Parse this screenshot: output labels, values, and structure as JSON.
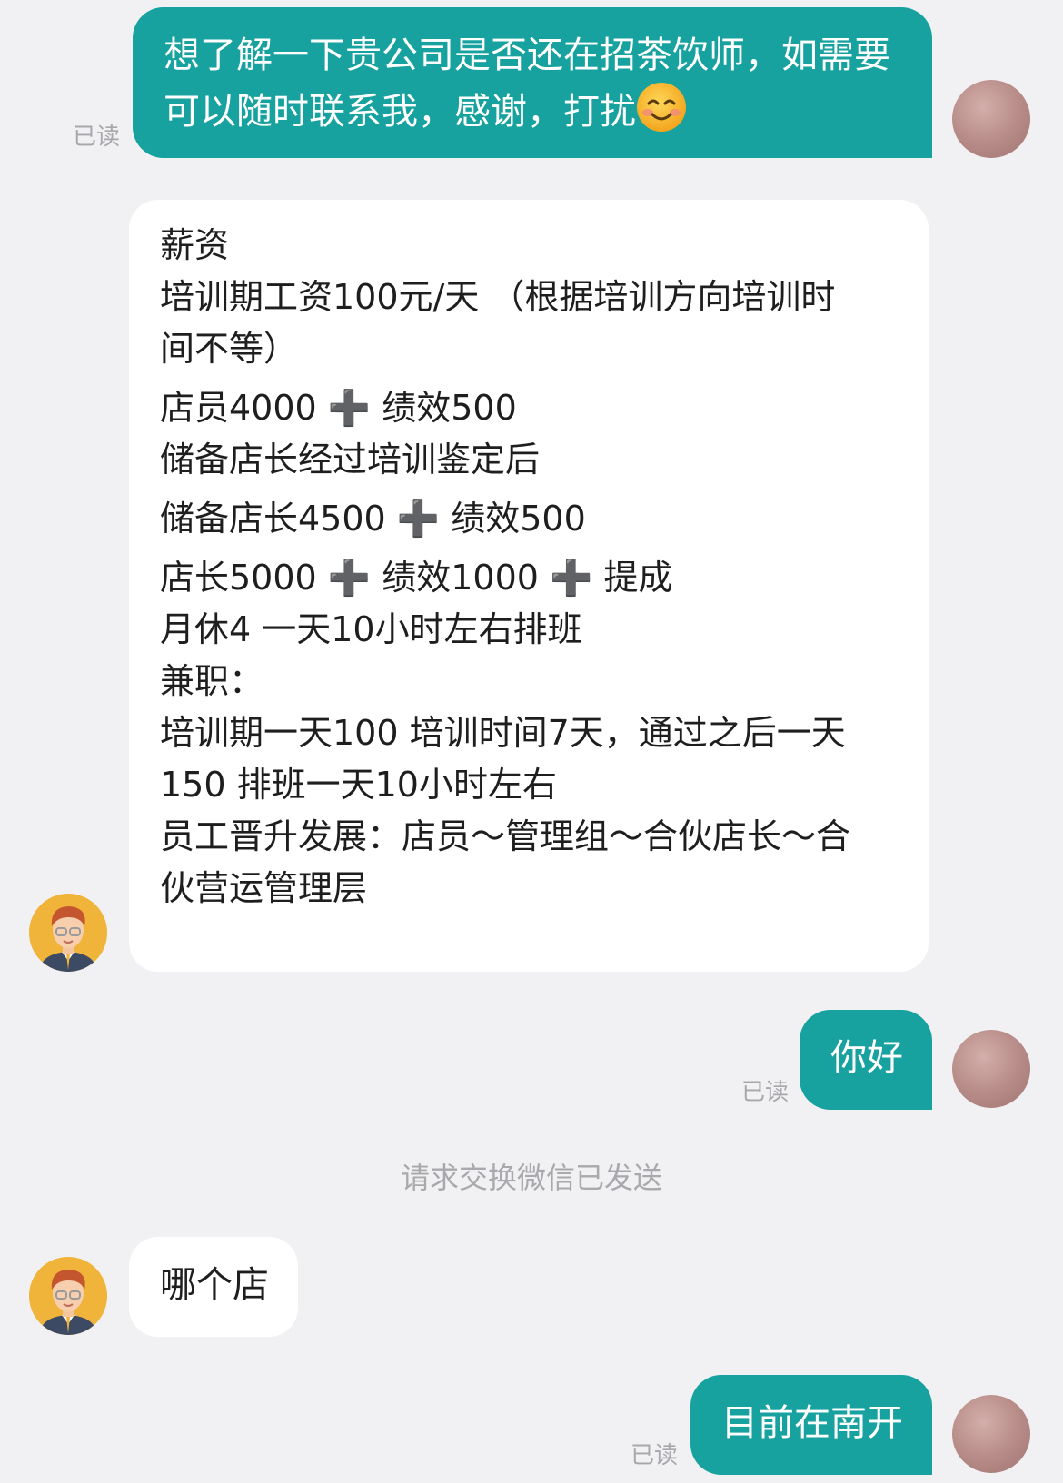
{
  "messages": [
    {
      "type": "outgoing",
      "text_main": "想了解一下贵公司是否还在招茶饮师，如需要",
      "text_second": "可以随时联系我，感谢，打扰",
      "emoji": "smiling-face-emoji",
      "read_label": "已读"
    },
    {
      "type": "incoming",
      "lines": [
        "薪资",
        "培训期工资100元/天 （根据培训方向培训时",
        "间不等）"
      ],
      "salary_lines": [
        {
          "before": "店员4000",
          "after": "绩效500"
        },
        {
          "before": "储备店长经过培训鉴定后",
          "after": ""
        },
        {
          "before": "储备店长4500",
          "after": "绩效500"
        }
      ],
      "manager_line": {
        "part1": "店长5000",
        "part2": "绩效1000",
        "part3": "提成"
      },
      "tail_lines": [
        "月休4 一天10小时左右排班",
        "兼职：",
        "培训期一天100 培训时间7天，通过之后一天",
        "150 排班一天10小时左右",
        "员工晋升发展：店员～管理组～合伙店长～合",
        "伙营运管理层"
      ],
      "plus_symbol": "➕"
    },
    {
      "type": "outgoing",
      "text": "你好",
      "read_label": "已读"
    },
    {
      "type": "system",
      "text": "请求交换微信已发送"
    },
    {
      "type": "incoming",
      "text": "哪个店"
    },
    {
      "type": "outgoing",
      "text": "目前在南开",
      "read_label": "已读"
    }
  ],
  "colors": {
    "background": "#f1f1f3",
    "outgoing_bubble": "#17a2a0",
    "incoming_bubble": "#ffffff",
    "read_text": "#a8a8ac"
  }
}
